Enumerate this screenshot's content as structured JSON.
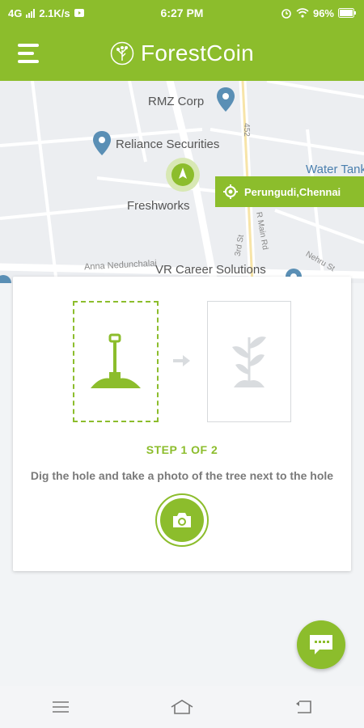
{
  "status_bar": {
    "network": "4G",
    "speed": "2.1K/s",
    "time": "6:27 PM",
    "battery": "96%"
  },
  "header": {
    "app_name": "ForestCoin"
  },
  "map": {
    "labels": {
      "rmz": "RMZ Corp",
      "reliance": "Reliance Securities",
      "freshworks": "Freshworks",
      "water_tank": "Water Tank",
      "vr_career": "VR Career Solutions",
      "anna": "Anna Nedunchalai",
      "road_452": "452",
      "main_rd": "R Main Rd",
      "third_st": "3rd St",
      "nehru_st": "Nehru St"
    },
    "location_chip": "Perungudi,Chennai"
  },
  "card": {
    "step_title": "STEP 1 OF 2",
    "step_description": "Dig the hole and take a photo of the tree next to the hole"
  },
  "colors": {
    "brand_green": "#8cbd2c",
    "map_bg": "#eceef1"
  }
}
